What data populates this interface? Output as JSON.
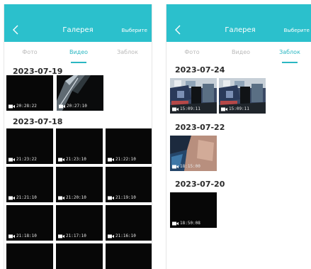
{
  "screens": [
    {
      "header": {
        "title": "Галерея",
        "select_label": "Выберите"
      },
      "tabs": [
        {
          "label": "Фото",
          "active": false
        },
        {
          "label": "Видео",
          "active": true
        },
        {
          "label": "Заблок",
          "active": false
        }
      ],
      "sections": [
        {
          "date": "2023-07-19",
          "videos": [
            "20:28:22",
            "20:27:10"
          ]
        },
        {
          "date": "2023-07-18",
          "videos": [
            "21:23:22",
            "21:23:10",
            "21:22:10",
            "21:21:10",
            "21:20:10",
            "21:19:10",
            "21:18:10",
            "21:17:10",
            "21:16:10",
            "",
            "",
            ""
          ]
        }
      ]
    },
    {
      "header": {
        "title": "Галерея",
        "select_label": "Выберите"
      },
      "tabs": [
        {
          "label": "Фото",
          "active": false
        },
        {
          "label": "Видео",
          "active": false
        },
        {
          "label": "Заблок",
          "active": true
        }
      ],
      "sections": [
        {
          "date": "2023-07-24",
          "videos": [
            "15:09:11",
            "15:09:11"
          ]
        },
        {
          "date": "2023-07-22",
          "videos": [
            "18:15:00"
          ]
        },
        {
          "date": "2023-07-20",
          "videos": [
            "18:50:08"
          ]
        }
      ]
    }
  ],
  "icons": {
    "back": "chevron-left-icon",
    "video": "video-camera-icon"
  },
  "colors": {
    "appbar": "#2bc0cc",
    "accent": "#2bb7c2",
    "thumb_bg": "#070707"
  }
}
